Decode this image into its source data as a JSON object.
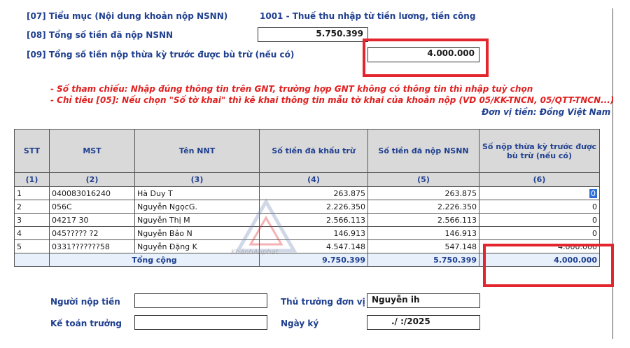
{
  "header": {
    "f07": {
      "label": "[07] Tiểu mục (Nội dung khoản nộp NSNN)",
      "value": "1001 - Thuế thu nhập từ tiền lương, tiền công"
    },
    "f08": {
      "label": "[08] Tổng số tiền đã nộp NSNN",
      "value": "5.750.399"
    },
    "f09": {
      "label": "[09] Tổng số tiền nộp thừa kỳ trước được bù trừ (nếu có)",
      "value": "4.000.000"
    }
  },
  "notes": {
    "line1": "- Số tham chiếu: Nhập đúng thông tin trên GNT, trường hợp GNT không có thông tin thì nhập tuỳ chọn",
    "line2": "- Chỉ tiêu [05]: Nếu chọn \"Số tờ khai\" thì kê khai thông tin mẫu tờ khai của khoản nộp (VD 05/KK-TNCN, 05/QTT-TNCN...)",
    "currency": "Đơn vị tiền: Đồng Việt Nam"
  },
  "table": {
    "columns": [
      "STT",
      "MST",
      "Tên NNT",
      "Số tiền đã khấu trừ",
      "Số tiền đã nộp NSNN",
      "Số nộp thừa kỳ trước được bù trừ (nếu có)"
    ],
    "col_numbers": [
      "(1)",
      "(2)",
      "(3)",
      "(4)",
      "(5)",
      "(6)"
    ],
    "rows": [
      {
        "stt": "1",
        "mst": "040083016240",
        "name": "Hà Duy T",
        "withheld": "263.875",
        "paid": "263.875",
        "offset": "0"
      },
      {
        "stt": "2",
        "mst": "056C       ",
        "name": "Nguyễn NgọcG.",
        "withheld": "2.226.350",
        "paid": "2.226.350",
        "offset": "0"
      },
      {
        "stt": "3",
        "mst": "04217       30",
        "name": "Nguyễn Thị M",
        "withheld": "2.566.113",
        "paid": "2.566.113",
        "offset": "0"
      },
      {
        "stt": "4",
        "mst": "045?????   ?2",
        "name": "Nguyễn Bảo N",
        "withheld": "146.913",
        "paid": "146.913",
        "offset": "0"
      },
      {
        "stt": "5",
        "mst": "0331???????58",
        "name": "Nguyễn Đặng K",
        "withheld": "4.547.148",
        "paid": "547.148",
        "offset": "4.000.000"
      }
    ],
    "total": {
      "label": "Tổng cộng",
      "withheld": "9.750.399",
      "paid": "5.750.399",
      "offset": "4.000.000"
    }
  },
  "footer": {
    "payer_label": "Người nộp tiền",
    "payer_value": "",
    "chief_accountant_label": "Kế toán trưởng",
    "chief_accountant_value": "",
    "head_label": "Thủ trưởng đơn vị",
    "head_value": "Nguyễn          ih",
    "date_label": "Ngày ký",
    "date_value": "  ./  :/2025"
  },
  "watermark": {
    "text": "KhánhAnphat"
  }
}
